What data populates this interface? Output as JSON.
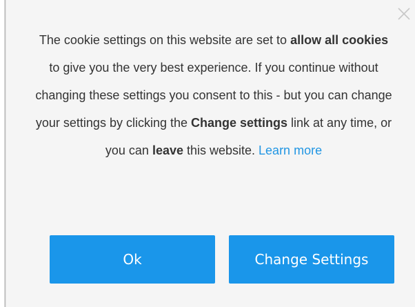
{
  "dialog": {
    "close_icon": "close-icon",
    "message": {
      "part1": "The cookie settings on this website are set to ",
      "bold1": "allow all cookies",
      "part2": " to give you the very best experience. If you continue without changing these settings you consent to this - but you can change your settings by clicking the ",
      "bold2": "Change settings",
      "part3": " link at any time, or you can ",
      "bold3": "leave",
      "part4": " this website. ",
      "learn_more": "Learn more"
    },
    "buttons": {
      "ok_label": "Ok",
      "change_settings_label": "Change Settings"
    },
    "colors": {
      "button_bg": "#1a96ea",
      "link": "#2196e3",
      "text": "#333333",
      "background": "#f5f5f5"
    }
  }
}
